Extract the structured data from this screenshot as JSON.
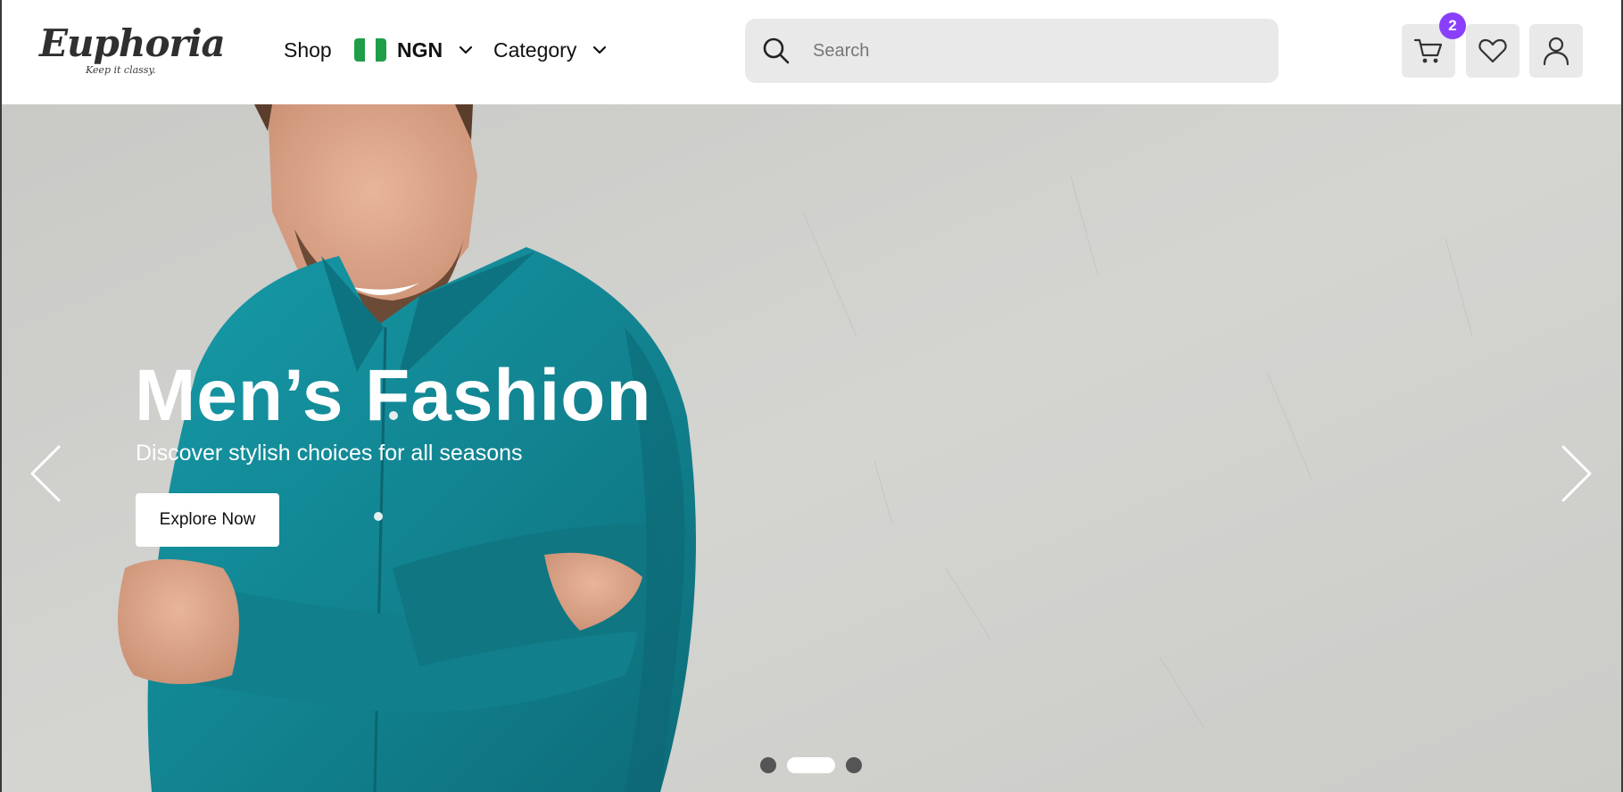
{
  "brand": {
    "name": "Euphoria",
    "tagline": "Keep it classy."
  },
  "nav": {
    "shop_label": "Shop",
    "currency_label": "NGN",
    "currency_flag": "nigeria-flag",
    "category_label": "Category"
  },
  "search": {
    "placeholder": "Search",
    "value": ""
  },
  "actions": {
    "cart_icon": "cart-icon",
    "cart_count": "2",
    "wishlist_icon": "heart-icon",
    "account_icon": "user-icon"
  },
  "hero": {
    "title": "Men’s Fashion",
    "subtitle": "Discover stylish choices for all seasons",
    "cta_label": "Explore Now",
    "slides_total": 3,
    "active_slide": 2
  },
  "colors": {
    "accent": "#8a3ffc",
    "flag_green": "#1f9e4a",
    "flag_white": "#ffffff",
    "shirt_teal": "#13808f",
    "wall_grey": "#cfcfcc"
  }
}
